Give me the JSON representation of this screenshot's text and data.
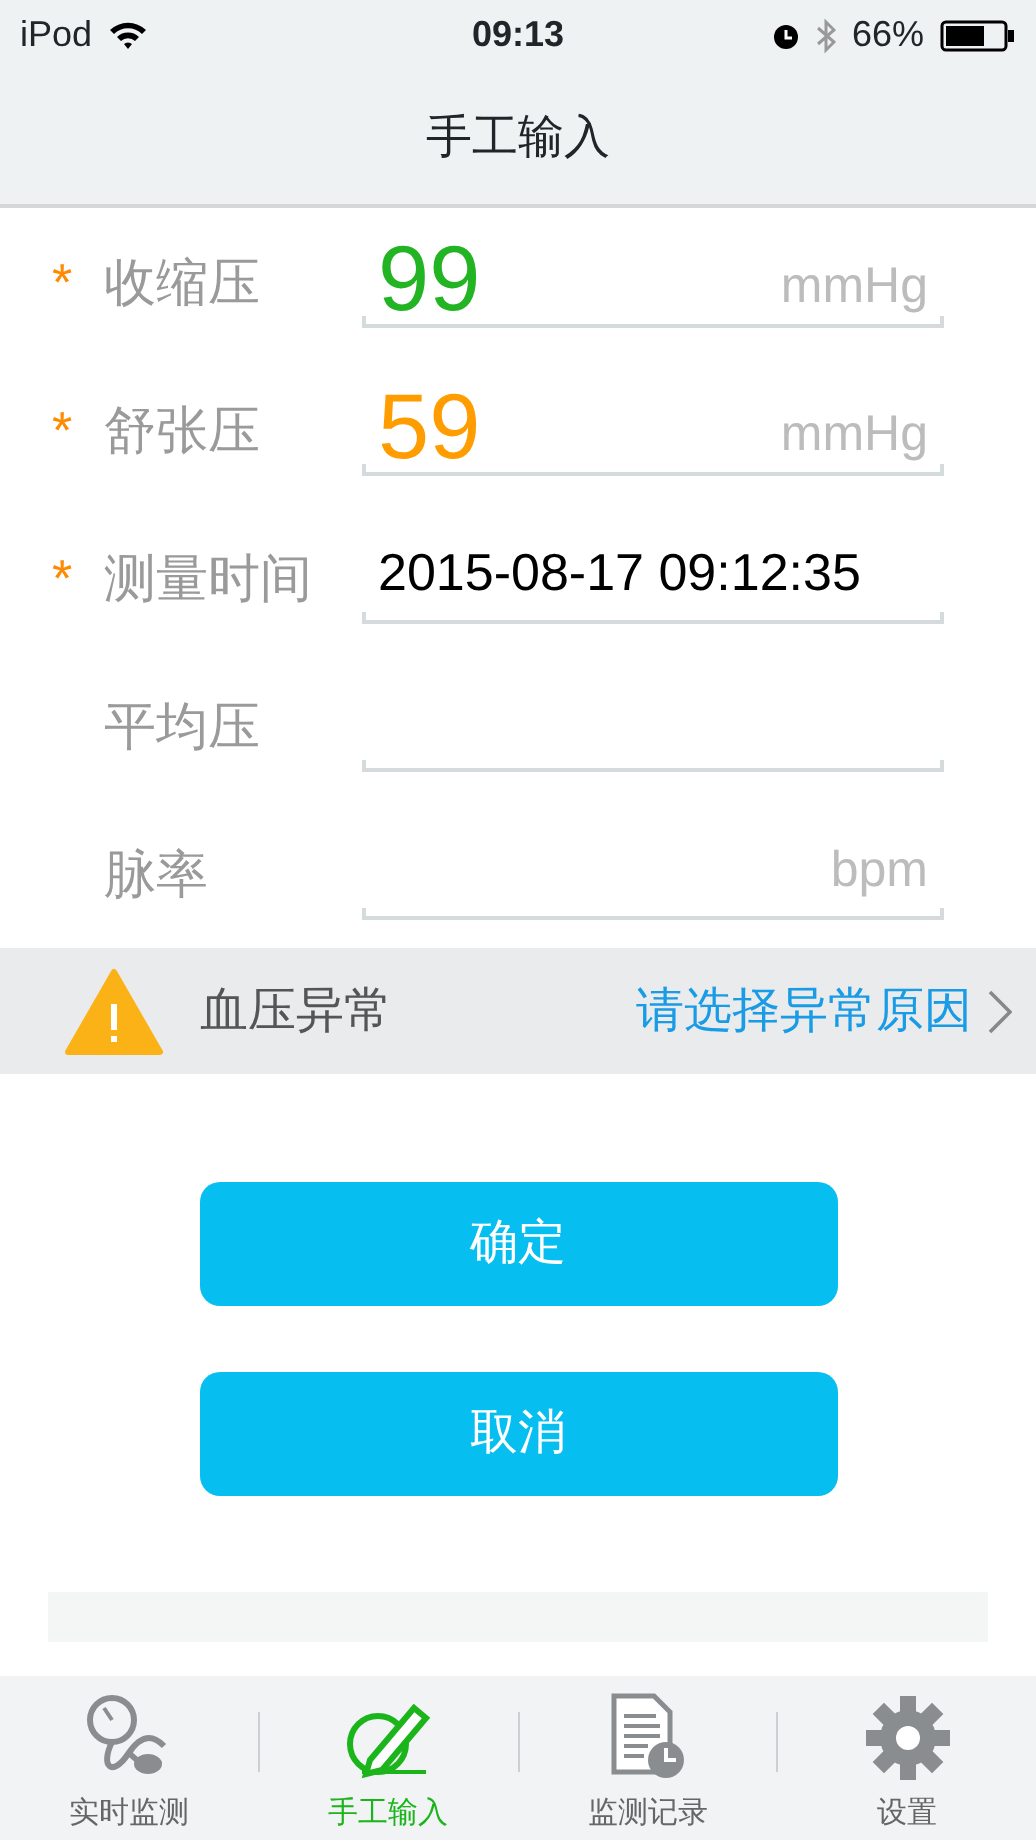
{
  "status_bar": {
    "carrier": "iPod",
    "time": "09:13",
    "battery": "66%"
  },
  "nav": {
    "title": "手工输入"
  },
  "fields": [
    {
      "label": "收缩压",
      "marker": "*",
      "value": "99",
      "unit": "mmHg",
      "color": "#22b422",
      "kind": "big"
    },
    {
      "label": "舒张压",
      "marker": "*",
      "value": "59",
      "unit": "mmHg",
      "color": "#ff9d00",
      "kind": "big"
    },
    {
      "label": "测量时间",
      "marker": "*",
      "value": "2015-08-17 09:12:35",
      "color": "#000000",
      "kind": "normal"
    },
    {
      "label": "平均压",
      "kind": "normal"
    },
    {
      "label": "脉率",
      "unit": "bpm",
      "kind": "normal"
    }
  ],
  "alert": {
    "label": "血压异常",
    "action": "请选择异常原因"
  },
  "buttons": [
    "确定",
    "取消"
  ],
  "tabs": [
    {
      "label": "实时监测",
      "kind": "gauge",
      "selected": false
    },
    {
      "label": "手工输入",
      "kind": "pencil",
      "selected": true
    },
    {
      "label": "监测记录",
      "kind": "record",
      "selected": false
    },
    {
      "label": "设置",
      "kind": "gear",
      "selected": false
    }
  ]
}
